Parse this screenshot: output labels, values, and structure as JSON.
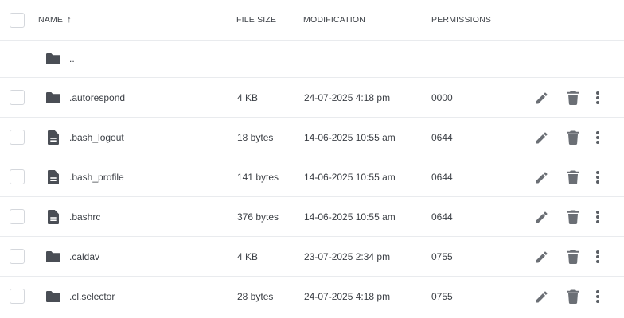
{
  "header": {
    "name": "NAME",
    "sort_arrow": "↑",
    "file_size": "FILE SIZE",
    "modification": "MODIFICATION",
    "permissions": "PERMISSIONS"
  },
  "parent": {
    "name": "..",
    "icon": "folder-icon"
  },
  "rows": [
    {
      "name": ".autorespond",
      "type": "folder",
      "size": "4 KB",
      "modified": "24-07-2025 4:18 pm",
      "permissions": "0000"
    },
    {
      "name": ".bash_logout",
      "type": "file",
      "size": "18 bytes",
      "modified": "14-06-2025 10:55 am",
      "permissions": "0644"
    },
    {
      "name": ".bash_profile",
      "type": "file",
      "size": "141 bytes",
      "modified": "14-06-2025 10:55 am",
      "permissions": "0644"
    },
    {
      "name": ".bashrc",
      "type": "file",
      "size": "376 bytes",
      "modified": "14-06-2025 10:55 am",
      "permissions": "0644"
    },
    {
      "name": ".caldav",
      "type": "folder",
      "size": "4 KB",
      "modified": "23-07-2025 2:34 pm",
      "permissions": "0755"
    },
    {
      "name": ".cl.selector",
      "type": "folder",
      "size": "28 bytes",
      "modified": "24-07-2025 4:18 pm",
      "permissions": "0755"
    }
  ],
  "icons": {
    "folder": "folder-icon",
    "file": "file-icon",
    "edit": "pencil-icon",
    "delete": "trash-icon",
    "more": "more-vertical-icon"
  },
  "colors": {
    "icon": "#4a4e55",
    "action_icon": "#6b6f75",
    "border": "#e9ebee",
    "checkbox_border": "#d4d7dc"
  }
}
